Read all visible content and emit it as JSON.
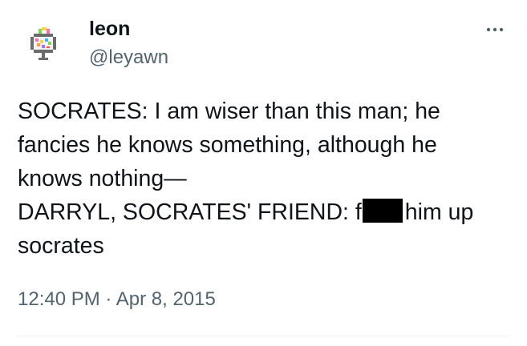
{
  "tweet": {
    "author": {
      "display_name": "leon",
      "handle": "@leyawn",
      "avatar_icon": "pixel-art-avatar-icon"
    },
    "more_icon": "more-horizontal-icon",
    "text": {
      "line1": "SOCRATES: I am wiser than this man; he",
      "line2": "fancies he knows something, although he",
      "line3": "knows nothing—",
      "line4_before": "DARRYL, SOCRATES' FRIEND: f",
      "line4_after": "him up",
      "line5": "socrates"
    },
    "time": "12:40 PM",
    "separator": "·",
    "date": "Apr 8, 2015"
  },
  "colors": {
    "text_primary": "#0f1419",
    "text_secondary": "#536471",
    "divider": "#eff3f4",
    "redaction": "#000000"
  }
}
